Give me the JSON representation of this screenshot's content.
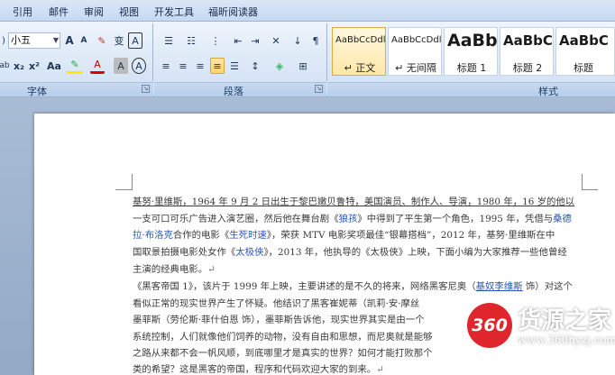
{
  "menu": {
    "tabs": [
      "引用",
      "邮件",
      "审阅",
      "视图",
      "开发工具",
      "福昕阅读器"
    ]
  },
  "ribbon": {
    "font_size_value": "小五",
    "groups": {
      "font": "字体",
      "paragraph": "段落",
      "styles": "样式"
    },
    "font_buttons": {
      "grow": "A",
      "shrink": "A",
      "phonetic": "变",
      "enclose": "A",
      "subscript": "x₂",
      "superscript": "x²",
      "change_case": "Aa",
      "font_color": "A",
      "char_shading": "A",
      "char_border": "A"
    },
    "styles": [
      {
        "sample": "AaBbCcDdl",
        "name": "正文",
        "selected": true
      },
      {
        "sample": "AaBbCcDdl",
        "name": "无间隔",
        "selected": false
      },
      {
        "sample": "AaBb",
        "name": "标题 1",
        "selected": false
      },
      {
        "sample": "AaBbC",
        "name": "标题 2",
        "selected": false
      },
      {
        "sample": "AaBbC",
        "name": "标题",
        "selected": false
      }
    ],
    "style_prefixes": {
      "normal": "↵",
      "no_spacing": "↵"
    }
  },
  "document": {
    "lines": [
      {
        "text": "基努·里维斯，1964 年 9 月 2 日出生于黎巴嫩贝鲁特，美国演员、制作人、导演，1980 年，16 岁的他以"
      },
      {
        "pre": "一支可口可乐广告进入演艺圈，然后他在舞台剧《",
        "link": "狼孩",
        "post": "》中得到了平生第一个角色，1995 年，凭借与",
        "link2": "桑德"
      },
      {
        "pre": "",
        "link": "拉·布洛克",
        "post": "合作的电影《",
        "link2": "生死时速",
        "post2": "》，荣获 MTV 电影奖项最佳“银幕搭档”，2012 年，基努·里维斯在中"
      },
      {
        "pre": "国取景拍摄电影处女作《",
        "link": "太极侠",
        "post": "》，2013 年，他执导的《太极侠》上映，下面小编为大家推荐一些他曾经"
      },
      {
        "pre": "主演的经典电影。",
        "mark": "↵"
      },
      {
        "pre": "《黑客帝国 1》，该片于 1999 年上映，主要讲述的是不久的将来，网络黑客尼奥（",
        "link": "基奴李维斯",
        "post": " 饰）对这个"
      },
      {
        "pre": "看似正常的现实世界产生了怀疑。他结识了黑客崔妮蒂（凯莉·安·摩丝"
      },
      {
        "pre": "墨菲斯（劳伦斯·菲什伯恩 饰），墨菲斯告诉他，现实世界其实是由一个"
      },
      {
        "pre": "系统控制，人们就像他们饲养的动物，没有自由和思想，而尼奥就是能够"
      },
      {
        "pre": "之路从来都不会一帆风顺，到底哪里才是真实的世界？如何才能打败那个"
      },
      {
        "pre": "类的希望？这是黑客的帝国，程序和代码欢迎大家的到来。",
        "mark": "↵"
      }
    ]
  },
  "watermark": {
    "badge": "360",
    "brand": "货源之家",
    "url": "www.360hyzj.com",
    "colors": {
      "badge_bg": "#e0262d",
      "text": "#ffffff"
    }
  }
}
